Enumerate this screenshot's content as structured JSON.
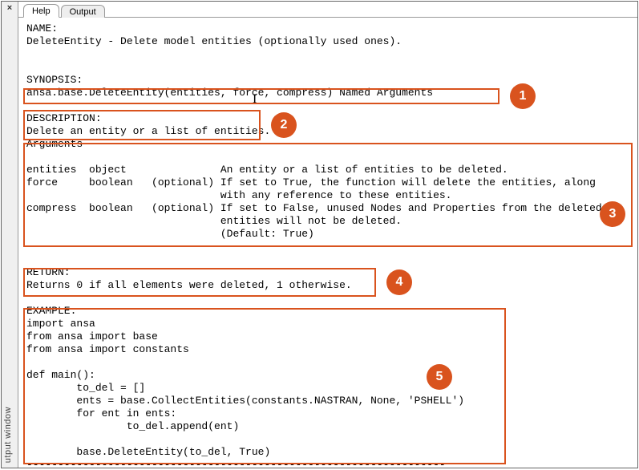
{
  "window": {
    "close_glyph": "×",
    "panel_label": "utput window"
  },
  "tabs": {
    "help": "Help",
    "output": "Output"
  },
  "doc": {
    "name_hdr": "NAME:",
    "name_line": "DeleteEntity - Delete model entities (optionally used ones).",
    "syn_hdr": "SYNOPSIS:",
    "syn_line": "ansa.base.DeleteEntity(entities, force, compress) Named Arguments",
    "desc_hdr": "DESCRIPTION:",
    "desc_line": "Delete an entity or a list of entities.",
    "args_hdr": "Arguments",
    "arg1": "entities  object               An entity or a list of entities to be deleted.",
    "arg2a": "force     boolean   (optional) If set to True, the function will delete the entities, along",
    "arg2b": "                               with any reference to these entities.",
    "arg3a": "compress  boolean   (optional) If set to False, unused Nodes and Properties from the deleted",
    "arg3b": "                               entities will not be deleted.",
    "arg3c": "                               (Default: True)",
    "ret_hdr": "RETURN:",
    "ret_line": "Returns 0 if all elements were deleted, 1 otherwise.",
    "ex_hdr": "EXAMPLE:",
    "ex1": "import ansa",
    "ex2": "from ansa import base",
    "ex3": "from ansa import constants",
    "ex4": "",
    "ex5": "def main():",
    "ex6": "        to_del = []",
    "ex7": "        ents = base.CollectEntities(constants.NASTRAN, None, 'PSHELL')",
    "ex8": "        for ent in ents:",
    "ex9": "                to_del.append(ent)",
    "ex10": "",
    "ex11": "        base.DeleteEntity(to_del, True)",
    "ex_rule": "-------------------------------------------------------------------"
  },
  "badges": {
    "b1": "1",
    "b2": "2",
    "b3": "3",
    "b4": "4",
    "b5": "5"
  }
}
